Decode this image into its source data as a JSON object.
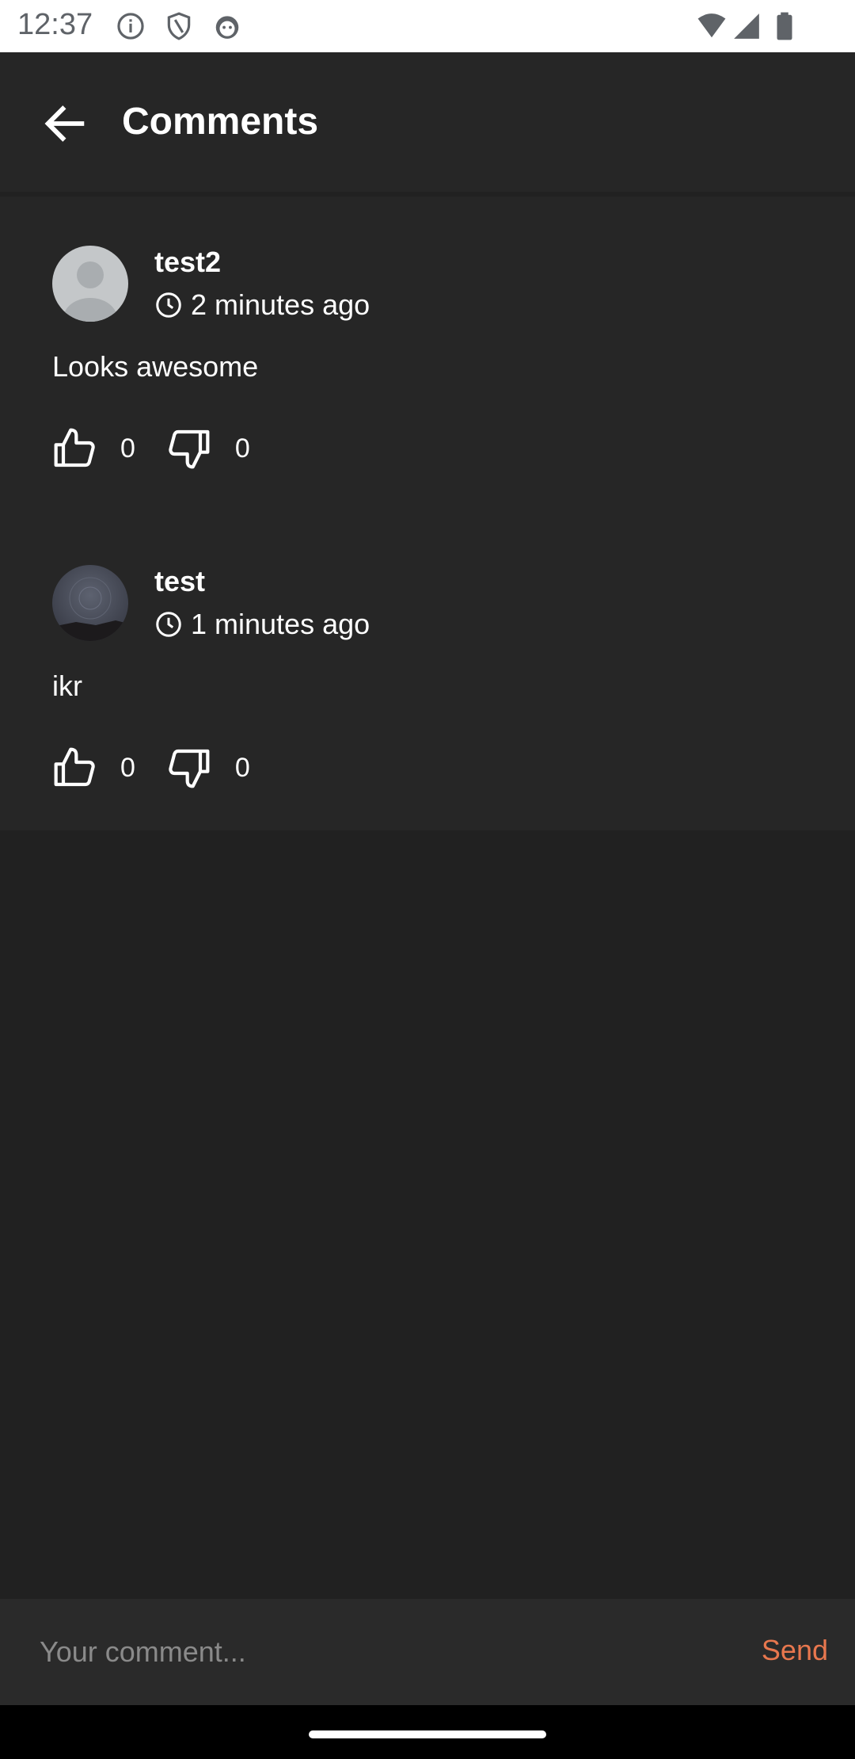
{
  "status_bar": {
    "time": "12:37",
    "left_icons": [
      "info-icon",
      "shield-icon",
      "cat-icon"
    ],
    "right_icons": [
      "wifi-icon",
      "signal-icon",
      "battery-icon"
    ]
  },
  "app_bar": {
    "title": "Comments",
    "back_icon": "arrow-left-icon"
  },
  "comments": [
    {
      "author": "test2",
      "timestamp": "2 minutes ago",
      "body": "Looks awesome",
      "avatar": "default-avatar",
      "likes": "0",
      "dislikes": "0"
    },
    {
      "author": "test",
      "timestamp": "1 minutes ago",
      "body": "ikr",
      "avatar": "photo-avatar",
      "likes": "0",
      "dislikes": "0"
    }
  ],
  "input": {
    "placeholder": "Your comment...",
    "value": "",
    "send_label": "Send"
  },
  "colors": {
    "background": "#212121",
    "card": "#262626",
    "accent": "#e8774e"
  }
}
